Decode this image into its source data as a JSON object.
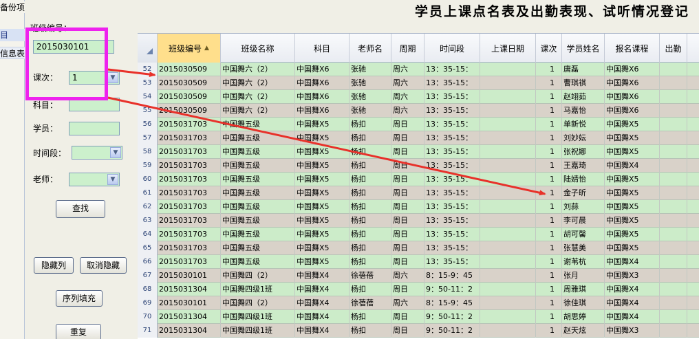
{
  "window": {
    "title": "学员上课点名表及出勤表现、试听情况登记"
  },
  "left_strip": {
    "backup_label": "备份项",
    "selected_label": "目",
    "info_label": "信息表"
  },
  "form": {
    "class_no_label": "班级编号：",
    "class_no_value": "2015030101",
    "lesson_label": "课次：",
    "lesson_value": "1",
    "subject_label": "科目：",
    "student_label": "学员：",
    "time_label": "时间段：",
    "teacher_label": "老师：",
    "search_button": "查找",
    "hide_col_button": "隐藏列",
    "unhide_button": "取消隐藏",
    "seq_fill_button": "序列填充",
    "reset_button": "重复"
  },
  "grid": {
    "columns": [
      "班级编号",
      "班级名称",
      "科目",
      "老师名",
      "周期",
      "时间段",
      "上课日期",
      "课次",
      "学员姓名",
      "报名课程",
      "出勤"
    ],
    "rows": [
      {
        "n": "52",
        "class_no": "2015030509",
        "class_name": "中国舞六（2）",
        "subject": "中国舞X6",
        "teacher": "张驰",
        "period": "周六",
        "time": "13：35-15：",
        "date": "",
        "lesson": "1",
        "student": "唐磊",
        "course": "中国舞X6",
        "att": ""
      },
      {
        "n": "53",
        "class_no": "2015030509",
        "class_name": "中国舞六（2）",
        "subject": "中国舞X6",
        "teacher": "张驰",
        "period": "周六",
        "time": "13：35-15：",
        "date": "",
        "lesson": "1",
        "student": "曹琪祺",
        "course": "中国舞X6",
        "att": ""
      },
      {
        "n": "54",
        "class_no": "2015030509",
        "class_name": "中国舞六（2）",
        "subject": "中国舞X6",
        "teacher": "张驰",
        "period": "周六",
        "time": "13：35-15：",
        "date": "",
        "lesson": "1",
        "student": "赵翊茹",
        "course": "中国舞X6",
        "att": ""
      },
      {
        "n": "55",
        "class_no": "2015030509",
        "class_name": "中国舞六（2）",
        "subject": "中国舞X6",
        "teacher": "张驰",
        "period": "周六",
        "time": "13：35-15：",
        "date": "",
        "lesson": "1",
        "student": "马嘉怡",
        "course": "中国舞X6",
        "att": ""
      },
      {
        "n": "56",
        "class_no": "2015031703",
        "class_name": "中国舞五级",
        "subject": "中国舞X5",
        "teacher": "杨扣",
        "period": "周日",
        "time": "13：35-15：",
        "date": "",
        "lesson": "1",
        "student": "单新悦",
        "course": "中国舞X5",
        "att": ""
      },
      {
        "n": "57",
        "class_no": "2015031703",
        "class_name": "中国舞五级",
        "subject": "中国舞X5",
        "teacher": "杨扣",
        "period": "周日",
        "time": "13：35-15：",
        "date": "",
        "lesson": "1",
        "student": "刘妙妘",
        "course": "中国舞X5",
        "att": ""
      },
      {
        "n": "58",
        "class_no": "2015031703",
        "class_name": "中国舞五级",
        "subject": "中国舞X5",
        "teacher": "杨扣",
        "period": "周日",
        "time": "13：35-15：",
        "date": "",
        "lesson": "1",
        "student": "张祝娜",
        "course": "中国舞X5",
        "att": ""
      },
      {
        "n": "59",
        "class_no": "2015031703",
        "class_name": "中国舞五级",
        "subject": "中国舞X5",
        "teacher": "杨扣",
        "period": "周日",
        "time": "13：35-15：",
        "date": "",
        "lesson": "1",
        "student": "王嘉琦",
        "course": "中国舞X4",
        "att": ""
      },
      {
        "n": "60",
        "class_no": "2015031703",
        "class_name": "中国舞五级",
        "subject": "中国舞X5",
        "teacher": "杨扣",
        "period": "周日",
        "time": "13：35-15：",
        "date": "",
        "lesson": "1",
        "student": "陆婧怡",
        "course": "中国舞X5",
        "att": ""
      },
      {
        "n": "61",
        "class_no": "2015031703",
        "class_name": "中国舞五级",
        "subject": "中国舞X5",
        "teacher": "杨扣",
        "period": "周日",
        "time": "13：35-15：",
        "date": "",
        "lesson": "1",
        "student": "金子昕",
        "course": "中国舞X5",
        "att": ""
      },
      {
        "n": "62",
        "class_no": "2015031703",
        "class_name": "中国舞五级",
        "subject": "中国舞X5",
        "teacher": "杨扣",
        "period": "周日",
        "time": "13：35-15：",
        "date": "",
        "lesson": "1",
        "student": "刘蒜",
        "course": "中国舞X5",
        "att": ""
      },
      {
        "n": "63",
        "class_no": "2015031703",
        "class_name": "中国舞五级",
        "subject": "中国舞X5",
        "teacher": "杨扣",
        "period": "周日",
        "time": "13：35-15：",
        "date": "",
        "lesson": "1",
        "student": "李可晨",
        "course": "中国舞X5",
        "att": ""
      },
      {
        "n": "64",
        "class_no": "2015031703",
        "class_name": "中国舞五级",
        "subject": "中国舞X5",
        "teacher": "杨扣",
        "period": "周日",
        "time": "13：35-15：",
        "date": "",
        "lesson": "1",
        "student": "胡可馨",
        "course": "中国舞X5",
        "att": ""
      },
      {
        "n": "65",
        "class_no": "2015031703",
        "class_name": "中国舞五级",
        "subject": "中国舞X5",
        "teacher": "杨扣",
        "period": "周日",
        "time": "13：35-15：",
        "date": "",
        "lesson": "1",
        "student": "张慧美",
        "course": "中国舞X5",
        "att": ""
      },
      {
        "n": "66",
        "class_no": "2015031703",
        "class_name": "中国舞五级",
        "subject": "中国舞X5",
        "teacher": "杨扣",
        "period": "周日",
        "time": "13：35-15：",
        "date": "",
        "lesson": "1",
        "student": "谢苇杭",
        "course": "中国舞X4",
        "att": ""
      },
      {
        "n": "67",
        "class_no": "2015030101",
        "class_name": "中国舞四（2）",
        "subject": "中国舞X4",
        "teacher": "徐蓓蓓",
        "period": "周六",
        "time": "8：15-9：45",
        "date": "",
        "lesson": "1",
        "student": "张月",
        "course": "中国舞X3",
        "att": ""
      },
      {
        "n": "68",
        "class_no": "2015031304",
        "class_name": "中国舞四级1班",
        "subject": "中国舞X4",
        "teacher": "杨扣",
        "period": "周日",
        "time": "9：50-11：2",
        "date": "",
        "lesson": "1",
        "student": "周雅琪",
        "course": "中国舞X4",
        "att": ""
      },
      {
        "n": "69",
        "class_no": "2015030101",
        "class_name": "中国舞四（2）",
        "subject": "中国舞X4",
        "teacher": "徐蓓蓓",
        "period": "周六",
        "time": "8：15-9：45",
        "date": "",
        "lesson": "1",
        "student": "徐佳琪",
        "course": "中国舞X4",
        "att": ""
      },
      {
        "n": "70",
        "class_no": "2015031304",
        "class_name": "中国舞四级1班",
        "subject": "中国舞X4",
        "teacher": "杨扣",
        "period": "周日",
        "time": "9：50-11：2",
        "date": "",
        "lesson": "1",
        "student": "胡思婷",
        "course": "中国舞X4",
        "att": ""
      },
      {
        "n": "71",
        "class_no": "2015031304",
        "class_name": "中国舞四级1班",
        "subject": "中国舞X4",
        "teacher": "杨扣",
        "period": "周日",
        "time": "9：50-11：2",
        "date": "",
        "lesson": "1",
        "student": "赵天炫",
        "course": "中国舞X3",
        "att": ""
      }
    ],
    "row_colors": {
      "green": "#ccecc9",
      "gray": "#d9d2c9"
    }
  },
  "annotation": {
    "highlight_color": "#ee22ee",
    "arrow_color": "#e8312a"
  }
}
